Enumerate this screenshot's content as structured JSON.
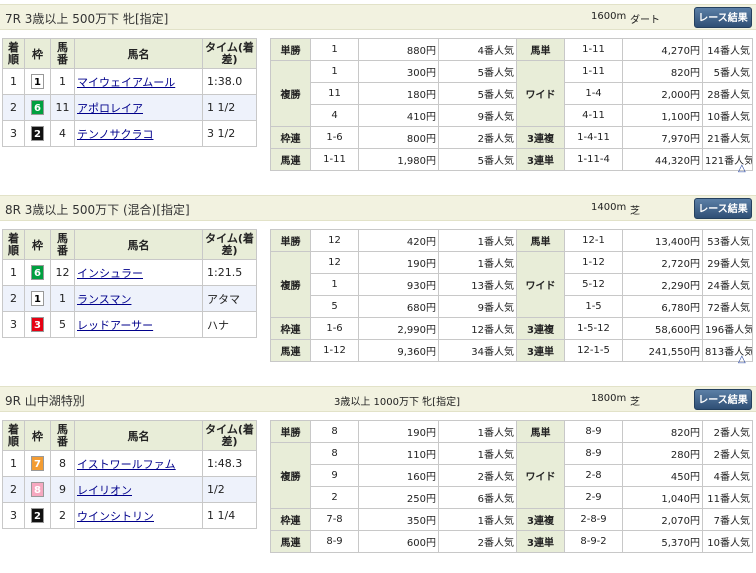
{
  "button_label": "レース結果",
  "headers": [
    "着順",
    "枠",
    "馬番",
    "馬名",
    "タイム(着差)"
  ],
  "payout_labels": {
    "tansho": "単勝",
    "fukusho": "複勝",
    "wakuren": "枠連",
    "umaren": "馬連",
    "umatan": "馬単",
    "wide": "ワイド",
    "sanrenpuku": "3連複",
    "sanrentan": "3連単"
  },
  "colors": {
    "waku1": "#ffffff",
    "waku2": "#111111",
    "waku3": "#e60012",
    "waku6": "#00a040",
    "waku7": "#f39c33",
    "waku8": "#f6a8c0"
  },
  "races": [
    {
      "title": "7R 3歳以上 500万下 牝[指定]",
      "cond": "",
      "dist": "1600m",
      "surface": "ダート",
      "results": [
        {
          "rank": "1",
          "waku": "1",
          "num": "1",
          "name": "マイウェイアムール",
          "time": "1:38.0"
        },
        {
          "rank": "2",
          "waku": "6",
          "num": "11",
          "name": "アポロレイア",
          "time": "1 1/2"
        },
        {
          "rank": "3",
          "waku": "2",
          "num": "4",
          "name": "テンノサクラコ",
          "time": "3 1/2"
        }
      ],
      "tansho": [
        {
          "c": "1",
          "p": "880円",
          "pop": "4番人気"
        }
      ],
      "fukusho": [
        {
          "c": "1",
          "p": "300円",
          "pop": "5番人気"
        },
        {
          "c": "11",
          "p": "180円",
          "pop": "5番人気"
        },
        {
          "c": "4",
          "p": "410円",
          "pop": "9番人気"
        }
      ],
      "wakuren": {
        "c": "1-6",
        "p": "800円",
        "pop": "2番人気"
      },
      "umaren": {
        "c": "1-11",
        "p": "1,980円",
        "pop": "5番人気"
      },
      "umatan": {
        "c": "1-11",
        "p": "4,270円",
        "pop": "14番人気"
      },
      "wide": [
        {
          "c": "1-11",
          "p": "820円",
          "pop": "5番人気"
        },
        {
          "c": "1-4",
          "p": "2,000円",
          "pop": "28番人気"
        },
        {
          "c": "4-11",
          "p": "1,100円",
          "pop": "10番人気"
        }
      ],
      "sanrenpuku": {
        "c": "1-4-11",
        "p": "7,970円",
        "pop": "21番人気"
      },
      "sanrentan": {
        "c": "1-11-4",
        "p": "44,320円",
        "pop": "121番人気"
      },
      "mark": "△"
    },
    {
      "title": "8R 3歳以上 500万下 (混合)[指定]",
      "cond": "",
      "dist": "1400m",
      "surface": "芝",
      "results": [
        {
          "rank": "1",
          "waku": "6",
          "num": "12",
          "name": "インシュラー",
          "time": "1:21.5"
        },
        {
          "rank": "2",
          "waku": "1",
          "num": "1",
          "name": "ランスマン",
          "time": "アタマ"
        },
        {
          "rank": "3",
          "waku": "3",
          "num": "5",
          "name": "レッドアーサー",
          "time": "ハナ"
        }
      ],
      "tansho": [
        {
          "c": "12",
          "p": "420円",
          "pop": "1番人気"
        }
      ],
      "fukusho": [
        {
          "c": "12",
          "p": "190円",
          "pop": "1番人気"
        },
        {
          "c": "1",
          "p": "930円",
          "pop": "13番人気"
        },
        {
          "c": "5",
          "p": "680円",
          "pop": "9番人気"
        }
      ],
      "wakuren": {
        "c": "1-6",
        "p": "2,990円",
        "pop": "12番人気"
      },
      "umaren": {
        "c": "1-12",
        "p": "9,360円",
        "pop": "34番人気"
      },
      "umatan": {
        "c": "12-1",
        "p": "13,400円",
        "pop": "53番人気"
      },
      "wide": [
        {
          "c": "1-12",
          "p": "2,720円",
          "pop": "29番人気"
        },
        {
          "c": "5-12",
          "p": "2,290円",
          "pop": "24番人気"
        },
        {
          "c": "1-5",
          "p": "6,780円",
          "pop": "72番人気"
        }
      ],
      "sanrenpuku": {
        "c": "1-5-12",
        "p": "58,600円",
        "pop": "196番人気"
      },
      "sanrentan": {
        "c": "12-1-5",
        "p": "241,550円",
        "pop": "813番人気"
      },
      "mark": "△"
    },
    {
      "title": "9R 山中湖特別",
      "cond": "3歳以上 1000万下 牝[指定]",
      "dist": "1800m",
      "surface": "芝",
      "results": [
        {
          "rank": "1",
          "waku": "7",
          "num": "8",
          "name": "イストワールファム",
          "time": "1:48.3"
        },
        {
          "rank": "2",
          "waku": "8",
          "num": "9",
          "name": "レイリオン",
          "time": "1/2"
        },
        {
          "rank": "3",
          "waku": "2",
          "num": "2",
          "name": "ウインシトリン",
          "time": "1 1/4"
        }
      ],
      "tansho": [
        {
          "c": "8",
          "p": "190円",
          "pop": "1番人気"
        }
      ],
      "fukusho": [
        {
          "c": "8",
          "p": "110円",
          "pop": "1番人気"
        },
        {
          "c": "9",
          "p": "160円",
          "pop": "2番人気"
        },
        {
          "c": "2",
          "p": "250円",
          "pop": "6番人気"
        }
      ],
      "wakuren": {
        "c": "7-8",
        "p": "350円",
        "pop": "1番人気"
      },
      "umaren": {
        "c": "8-9",
        "p": "600円",
        "pop": "2番人気"
      },
      "umatan": {
        "c": "8-9",
        "p": "820円",
        "pop": "2番人気"
      },
      "wide": [
        {
          "c": "8-9",
          "p": "280円",
          "pop": "2番人気"
        },
        {
          "c": "2-8",
          "p": "450円",
          "pop": "4番人気"
        },
        {
          "c": "2-9",
          "p": "1,040円",
          "pop": "11番人気"
        }
      ],
      "sanrenpuku": {
        "c": "2-8-9",
        "p": "2,070円",
        "pop": "7番人気"
      },
      "sanrentan": {
        "c": "8-9-2",
        "p": "5,370円",
        "pop": "10番人気"
      },
      "mark": ""
    }
  ]
}
